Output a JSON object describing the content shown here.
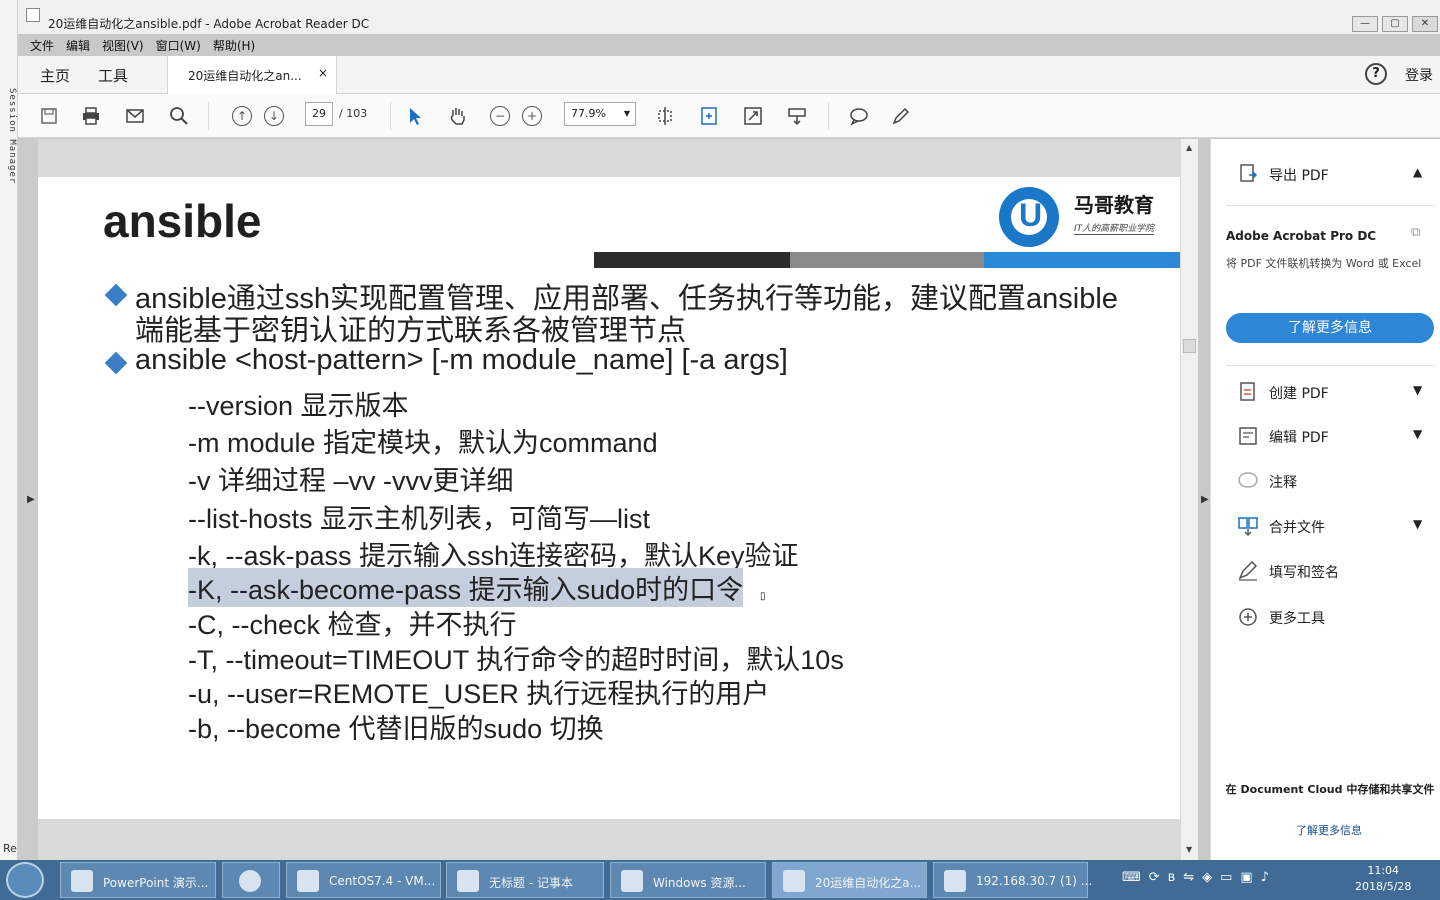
{
  "session_strip": {
    "label": "Session Manager",
    "bottom": "Re"
  },
  "window": {
    "title": "20运维自动化之ansible.pdf - Adobe Acrobat Reader DC",
    "minimize": "—",
    "restore": "▢",
    "close": "✕"
  },
  "menu": [
    "文件",
    "编辑",
    "视图(V)",
    "窗口(W)",
    "帮助(H)"
  ],
  "tabs": {
    "home": "主页",
    "tools": "工具",
    "document": "20运维自动化之an...",
    "close": "×",
    "help": "?",
    "login": "登录"
  },
  "toolbar": {
    "page_current": "29",
    "page_total": "/ 103",
    "zoom": "77.9%"
  },
  "slide": {
    "title": "ansible",
    "logo_glyph": "U",
    "logo_name": "马哥教育",
    "logo_sub": "IT人的高薪职业学院",
    "bullet1_line1": "ansible通过ssh实现配置管理、应用部署、任务执行等功能，建议配置ansible",
    "bullet1_line2": "端能基于密钥认证的方式联系各被管理节点",
    "bullet2": "ansible <host-pattern> [-m module_name] [-a args]",
    "options": [
      "--version  显示版本",
      "-m module   指定模块，默认为command",
      "-v 详细过程 –vv   -vvv更详细",
      "--list-hosts  显示主机列表，可简写—list",
      "-k, --ask-pass      提示输入ssh连接密码，默认Key验证",
      "-K, --ask-become-pass  提示输入sudo时的口令",
      "-C, --check   检查，并不执行",
      "-T, --timeout=TIMEOUT 执行命令的超时时间，默认10s",
      "-u, --user=REMOTE_USER 执行远程执行的用户",
      "-b, --become  代替旧版的sudo 切换"
    ]
  },
  "right_panel": {
    "export_pdf": "导出 PDF",
    "pro_title": "Adobe Acrobat Pro DC",
    "pro_desc": "将 PDF 文件联机转换为 Word 或 Excel",
    "learn_more_btn": "了解更多信息",
    "create_pdf": "创建 PDF",
    "edit_pdf": "编辑 PDF",
    "comment": "注释",
    "combine": "合并文件",
    "fill_sign": "填写和签名",
    "more_tools": "更多工具",
    "cloud_text": "在 Document Cloud 中存储和共享文件",
    "cloud_link": "了解更多信息"
  },
  "taskbar": {
    "items": [
      "PowerPoint 演示...",
      "",
      "CentOS7.4 - VM...",
      "无标题 - 记事本",
      "Windows 资源...",
      "20运维自动化之a...",
      "192.168.30.7 (1) ..."
    ],
    "time": "11:04",
    "date": "2018/5/28"
  }
}
